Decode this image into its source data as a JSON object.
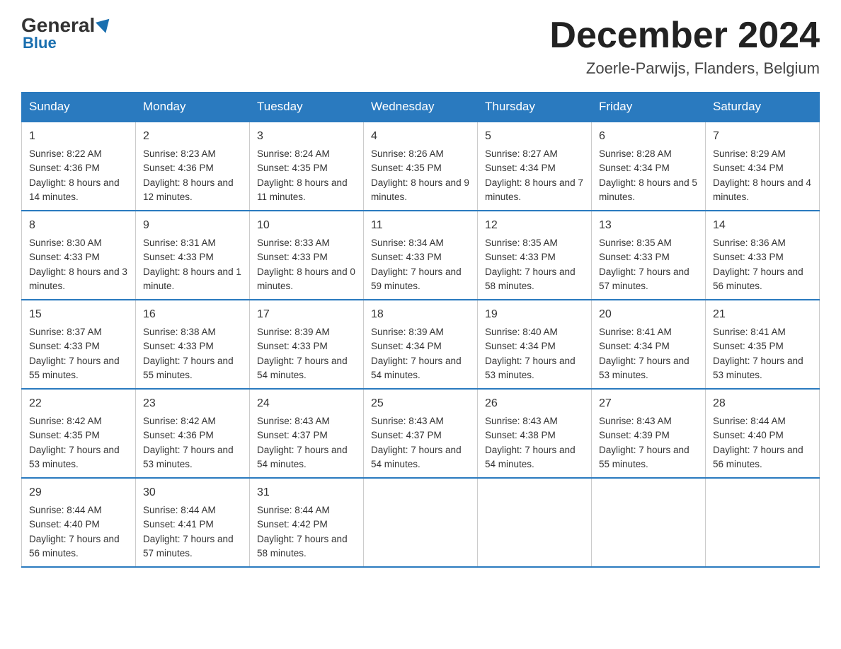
{
  "header": {
    "logo_general": "General",
    "logo_blue": "Blue",
    "month_title": "December 2024",
    "location": "Zoerle-Parwijs, Flanders, Belgium"
  },
  "days_of_week": [
    "Sunday",
    "Monday",
    "Tuesday",
    "Wednesday",
    "Thursday",
    "Friday",
    "Saturday"
  ],
  "weeks": [
    [
      {
        "day": "1",
        "sunrise": "Sunrise: 8:22 AM",
        "sunset": "Sunset: 4:36 PM",
        "daylight": "Daylight: 8 hours and 14 minutes."
      },
      {
        "day": "2",
        "sunrise": "Sunrise: 8:23 AM",
        "sunset": "Sunset: 4:36 PM",
        "daylight": "Daylight: 8 hours and 12 minutes."
      },
      {
        "day": "3",
        "sunrise": "Sunrise: 8:24 AM",
        "sunset": "Sunset: 4:35 PM",
        "daylight": "Daylight: 8 hours and 11 minutes."
      },
      {
        "day": "4",
        "sunrise": "Sunrise: 8:26 AM",
        "sunset": "Sunset: 4:35 PM",
        "daylight": "Daylight: 8 hours and 9 minutes."
      },
      {
        "day": "5",
        "sunrise": "Sunrise: 8:27 AM",
        "sunset": "Sunset: 4:34 PM",
        "daylight": "Daylight: 8 hours and 7 minutes."
      },
      {
        "day": "6",
        "sunrise": "Sunrise: 8:28 AM",
        "sunset": "Sunset: 4:34 PM",
        "daylight": "Daylight: 8 hours and 5 minutes."
      },
      {
        "day": "7",
        "sunrise": "Sunrise: 8:29 AM",
        "sunset": "Sunset: 4:34 PM",
        "daylight": "Daylight: 8 hours and 4 minutes."
      }
    ],
    [
      {
        "day": "8",
        "sunrise": "Sunrise: 8:30 AM",
        "sunset": "Sunset: 4:33 PM",
        "daylight": "Daylight: 8 hours and 3 minutes."
      },
      {
        "day": "9",
        "sunrise": "Sunrise: 8:31 AM",
        "sunset": "Sunset: 4:33 PM",
        "daylight": "Daylight: 8 hours and 1 minute."
      },
      {
        "day": "10",
        "sunrise": "Sunrise: 8:33 AM",
        "sunset": "Sunset: 4:33 PM",
        "daylight": "Daylight: 8 hours and 0 minutes."
      },
      {
        "day": "11",
        "sunrise": "Sunrise: 8:34 AM",
        "sunset": "Sunset: 4:33 PM",
        "daylight": "Daylight: 7 hours and 59 minutes."
      },
      {
        "day": "12",
        "sunrise": "Sunrise: 8:35 AM",
        "sunset": "Sunset: 4:33 PM",
        "daylight": "Daylight: 7 hours and 58 minutes."
      },
      {
        "day": "13",
        "sunrise": "Sunrise: 8:35 AM",
        "sunset": "Sunset: 4:33 PM",
        "daylight": "Daylight: 7 hours and 57 minutes."
      },
      {
        "day": "14",
        "sunrise": "Sunrise: 8:36 AM",
        "sunset": "Sunset: 4:33 PM",
        "daylight": "Daylight: 7 hours and 56 minutes."
      }
    ],
    [
      {
        "day": "15",
        "sunrise": "Sunrise: 8:37 AM",
        "sunset": "Sunset: 4:33 PM",
        "daylight": "Daylight: 7 hours and 55 minutes."
      },
      {
        "day": "16",
        "sunrise": "Sunrise: 8:38 AM",
        "sunset": "Sunset: 4:33 PM",
        "daylight": "Daylight: 7 hours and 55 minutes."
      },
      {
        "day": "17",
        "sunrise": "Sunrise: 8:39 AM",
        "sunset": "Sunset: 4:33 PM",
        "daylight": "Daylight: 7 hours and 54 minutes."
      },
      {
        "day": "18",
        "sunrise": "Sunrise: 8:39 AM",
        "sunset": "Sunset: 4:34 PM",
        "daylight": "Daylight: 7 hours and 54 minutes."
      },
      {
        "day": "19",
        "sunrise": "Sunrise: 8:40 AM",
        "sunset": "Sunset: 4:34 PM",
        "daylight": "Daylight: 7 hours and 53 minutes."
      },
      {
        "day": "20",
        "sunrise": "Sunrise: 8:41 AM",
        "sunset": "Sunset: 4:34 PM",
        "daylight": "Daylight: 7 hours and 53 minutes."
      },
      {
        "day": "21",
        "sunrise": "Sunrise: 8:41 AM",
        "sunset": "Sunset: 4:35 PM",
        "daylight": "Daylight: 7 hours and 53 minutes."
      }
    ],
    [
      {
        "day": "22",
        "sunrise": "Sunrise: 8:42 AM",
        "sunset": "Sunset: 4:35 PM",
        "daylight": "Daylight: 7 hours and 53 minutes."
      },
      {
        "day": "23",
        "sunrise": "Sunrise: 8:42 AM",
        "sunset": "Sunset: 4:36 PM",
        "daylight": "Daylight: 7 hours and 53 minutes."
      },
      {
        "day": "24",
        "sunrise": "Sunrise: 8:43 AM",
        "sunset": "Sunset: 4:37 PM",
        "daylight": "Daylight: 7 hours and 54 minutes."
      },
      {
        "day": "25",
        "sunrise": "Sunrise: 8:43 AM",
        "sunset": "Sunset: 4:37 PM",
        "daylight": "Daylight: 7 hours and 54 minutes."
      },
      {
        "day": "26",
        "sunrise": "Sunrise: 8:43 AM",
        "sunset": "Sunset: 4:38 PM",
        "daylight": "Daylight: 7 hours and 54 minutes."
      },
      {
        "day": "27",
        "sunrise": "Sunrise: 8:43 AM",
        "sunset": "Sunset: 4:39 PM",
        "daylight": "Daylight: 7 hours and 55 minutes."
      },
      {
        "day": "28",
        "sunrise": "Sunrise: 8:44 AM",
        "sunset": "Sunset: 4:40 PM",
        "daylight": "Daylight: 7 hours and 56 minutes."
      }
    ],
    [
      {
        "day": "29",
        "sunrise": "Sunrise: 8:44 AM",
        "sunset": "Sunset: 4:40 PM",
        "daylight": "Daylight: 7 hours and 56 minutes."
      },
      {
        "day": "30",
        "sunrise": "Sunrise: 8:44 AM",
        "sunset": "Sunset: 4:41 PM",
        "daylight": "Daylight: 7 hours and 57 minutes."
      },
      {
        "day": "31",
        "sunrise": "Sunrise: 8:44 AM",
        "sunset": "Sunset: 4:42 PM",
        "daylight": "Daylight: 7 hours and 58 minutes."
      },
      null,
      null,
      null,
      null
    ]
  ]
}
